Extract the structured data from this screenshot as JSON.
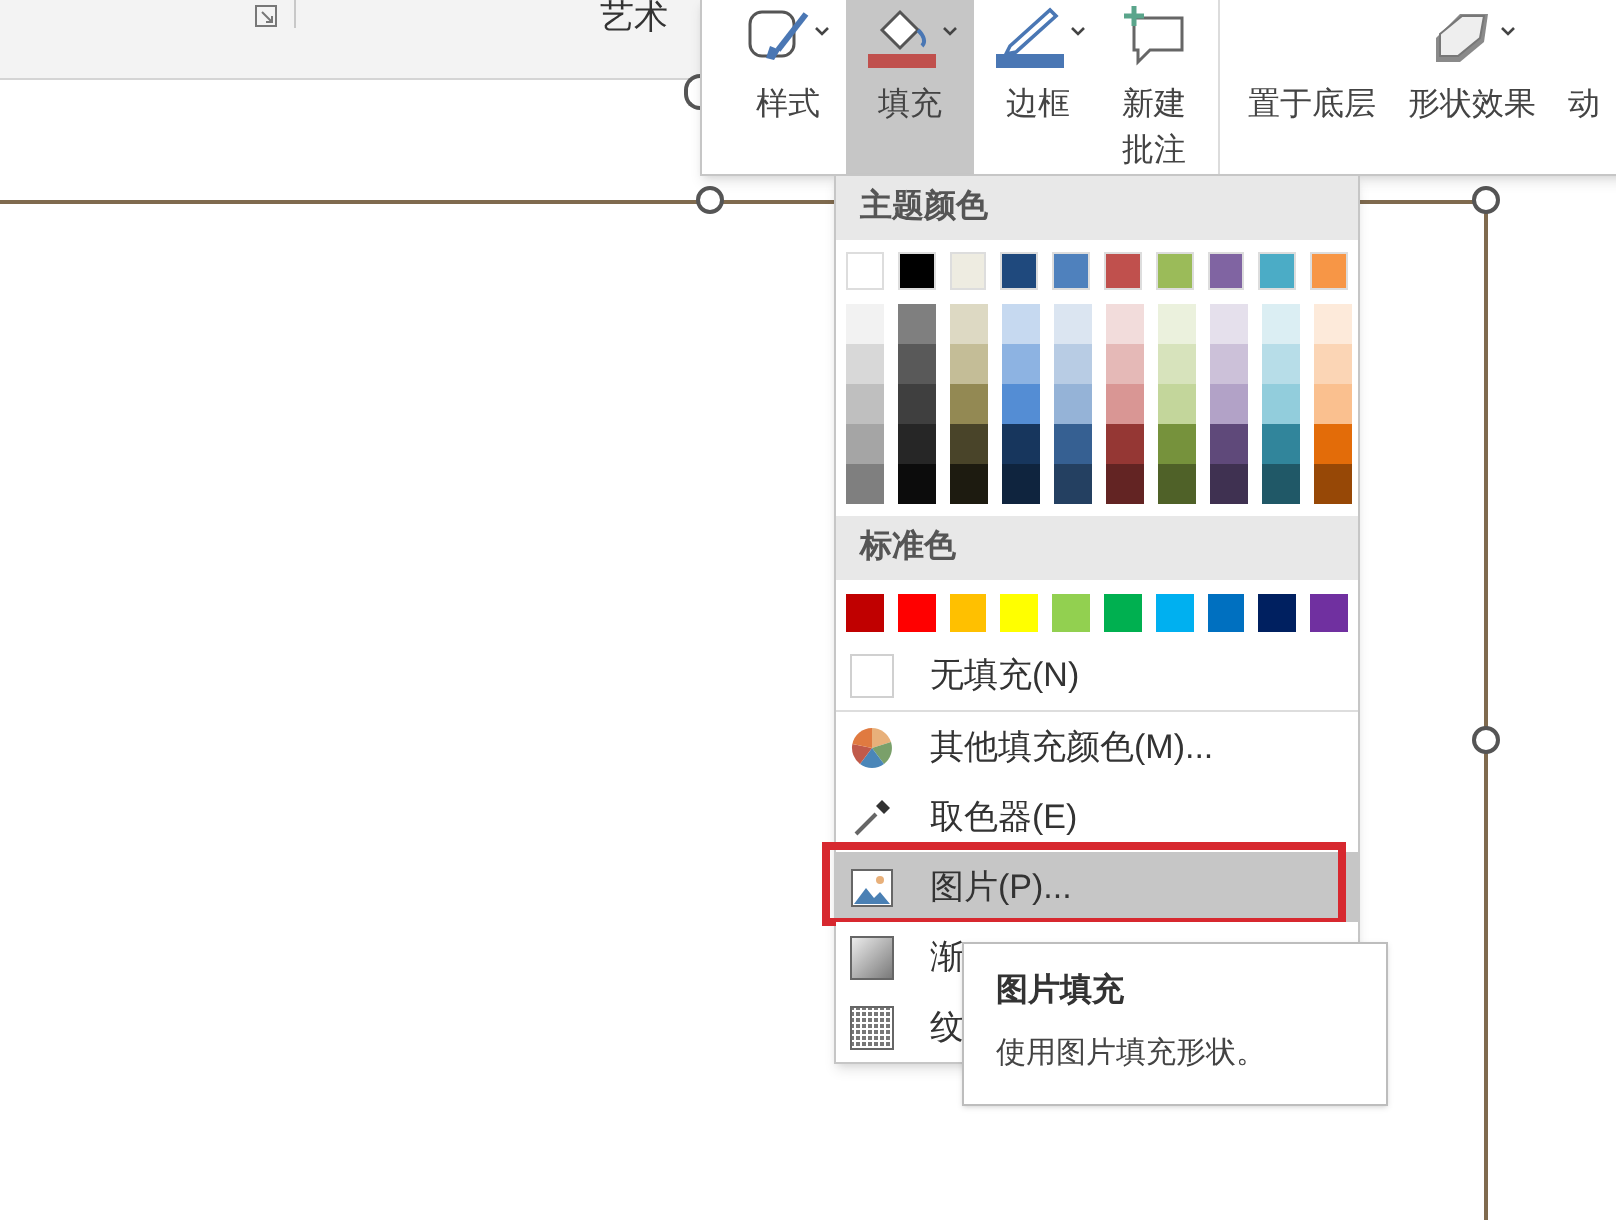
{
  "top_bar": {
    "group_label": "艺术"
  },
  "ribbon": {
    "buttons": [
      {
        "label": "样式",
        "kind": "style",
        "dropdown": true,
        "selected": false
      },
      {
        "label": "填充",
        "kind": "fill",
        "dropdown": true,
        "selected": true
      },
      {
        "label": "边框",
        "kind": "outline",
        "dropdown": true,
        "selected": false
      },
      {
        "label": "新建批注",
        "kind": "comment",
        "dropdown": false,
        "selected": false
      },
      {
        "label": "置于底层",
        "kind": "layers",
        "dropdown": false,
        "selected": false
      },
      {
        "label": "形状效果",
        "kind": "effects",
        "dropdown": true,
        "selected": false
      },
      {
        "label": "动",
        "kind": "plain",
        "dropdown": false,
        "selected": false
      }
    ]
  },
  "fill_menu": {
    "theme_header": "主题颜色",
    "theme_colors": [
      {
        "color": "#ffffff",
        "shades": [
          {
            "color": "#f2f2f2"
          },
          {
            "color": "#d8d8d8"
          },
          {
            "color": "#bfbfbf"
          },
          {
            "color": "#a5a5a5"
          },
          {
            "color": "#7f7f7f"
          }
        ]
      },
      {
        "color": "#000000",
        "shades": [
          {
            "color": "#7f7f7f"
          },
          {
            "color": "#595959"
          },
          {
            "color": "#3f3f3f"
          },
          {
            "color": "#262626"
          },
          {
            "color": "#0c0c0c"
          }
        ]
      },
      {
        "color": "#eeece1",
        "shades": [
          {
            "color": "#ddd9c3"
          },
          {
            "color": "#c4bd97"
          },
          {
            "color": "#938953"
          },
          {
            "color": "#494429"
          },
          {
            "color": "#1d1b10"
          }
        ]
      },
      {
        "color": "#1f497d",
        "shades": [
          {
            "color": "#c6d9f0"
          },
          {
            "color": "#8db3e2"
          },
          {
            "color": "#548dd4"
          },
          {
            "color": "#17365d"
          },
          {
            "color": "#0f243e"
          }
        ]
      },
      {
        "color": "#4f81bd",
        "shades": [
          {
            "color": "#dbe5f1"
          },
          {
            "color": "#b8cce4"
          },
          {
            "color": "#95b3d7"
          },
          {
            "color": "#366092"
          },
          {
            "color": "#244061"
          }
        ]
      },
      {
        "color": "#c0504d",
        "shades": [
          {
            "color": "#f2dcdb"
          },
          {
            "color": "#e5b9b7"
          },
          {
            "color": "#d99694"
          },
          {
            "color": "#953734"
          },
          {
            "color": "#632423"
          }
        ]
      },
      {
        "color": "#9bbb59",
        "shades": [
          {
            "color": "#ebf1dd"
          },
          {
            "color": "#d7e3bc"
          },
          {
            "color": "#c3d69b"
          },
          {
            "color": "#76923c"
          },
          {
            "color": "#4f6128"
          }
        ]
      },
      {
        "color": "#8064a2",
        "shades": [
          {
            "color": "#e5e0ec"
          },
          {
            "color": "#ccc1d9"
          },
          {
            "color": "#b2a2c7"
          },
          {
            "color": "#5f497a"
          },
          {
            "color": "#3f3151"
          }
        ]
      },
      {
        "color": "#4bacc6",
        "shades": [
          {
            "color": "#dbeef3"
          },
          {
            "color": "#b7dde8"
          },
          {
            "color": "#92cddc"
          },
          {
            "color": "#31859b"
          },
          {
            "color": "#205867"
          }
        ]
      },
      {
        "color": "#f79646",
        "shades": [
          {
            "color": "#fdeada"
          },
          {
            "color": "#fbd5b5"
          },
          {
            "color": "#fac08f"
          },
          {
            "color": "#e36c09"
          },
          {
            "color": "#974806"
          }
        ]
      }
    ],
    "standard_header": "标准色",
    "standard_colors": [
      {
        "color": "#c00000"
      },
      {
        "color": "#ff0000"
      },
      {
        "color": "#ffc000"
      },
      {
        "color": "#ffff00"
      },
      {
        "color": "#92d050"
      },
      {
        "color": "#00b050"
      },
      {
        "color": "#00b0f0"
      },
      {
        "color": "#0070c0"
      },
      {
        "color": "#002060"
      },
      {
        "color": "#7030a0"
      }
    ],
    "items": [
      {
        "label": "无填充(N)",
        "kind": "blank",
        "selected": false,
        "boxed": false,
        "divider_after": true
      },
      {
        "label": "其他填充颜色(M)...",
        "kind": "palette",
        "selected": false,
        "boxed": false,
        "divider_after": false
      },
      {
        "label": "取色器(E)",
        "kind": "eyedropper",
        "selected": false,
        "boxed": false,
        "divider_after": false
      },
      {
        "label": "图片(P)...",
        "kind": "picture",
        "selected": true,
        "boxed": true,
        "divider_after": false
      },
      {
        "label": "渐",
        "kind": "gradient",
        "selected": false,
        "boxed": false,
        "divider_after": false
      },
      {
        "label": "纹",
        "kind": "texture",
        "selected": false,
        "boxed": false,
        "divider_after": false
      }
    ]
  },
  "tooltip": {
    "title": "图片填充",
    "text": "使用图片填充形状。"
  }
}
